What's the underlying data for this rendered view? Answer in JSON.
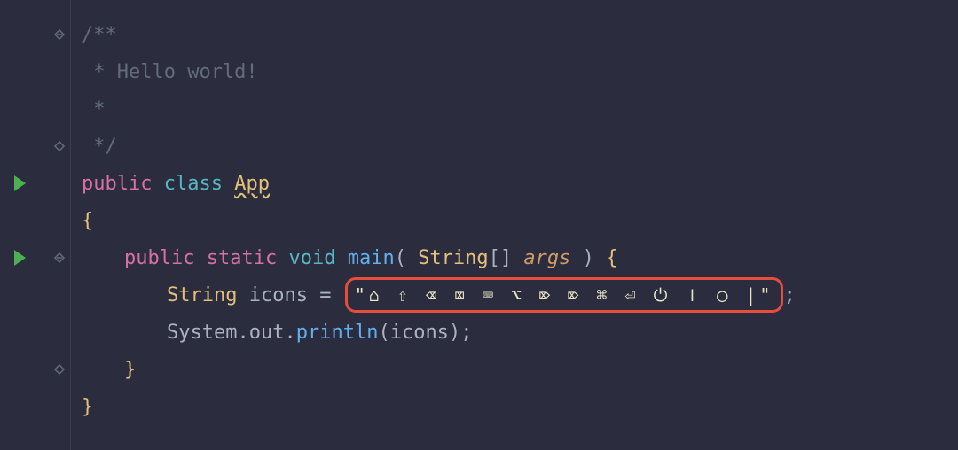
{
  "code": {
    "comment_open": "/**",
    "comment_line1": " * Hello world!",
    "comment_line2": " *",
    "comment_close": " */",
    "public_kw": "public",
    "class_kw": "class",
    "class_name": "App",
    "brace_open": "{",
    "brace_close": "}",
    "static_kw": "static",
    "void_kw": "void",
    "main_method": "main",
    "paren_open": "(",
    "paren_close": ")",
    "string_type": "String",
    "brackets": "[]",
    "args_param": "args",
    "icons_var": "icons",
    "equals": " = ",
    "icons_string": "\"⌂ ⇧ ⌫ ⌧ ⌨ ⌥ ⌦ ⌦ ⌘ ⏎ ⏻ ⏽ ◯ |\"",
    "semi": ";",
    "system_ident": "System",
    "out_ident": "out",
    "println_method": "println",
    "dot": ".",
    "icons_arg": "icons",
    "space": " "
  }
}
